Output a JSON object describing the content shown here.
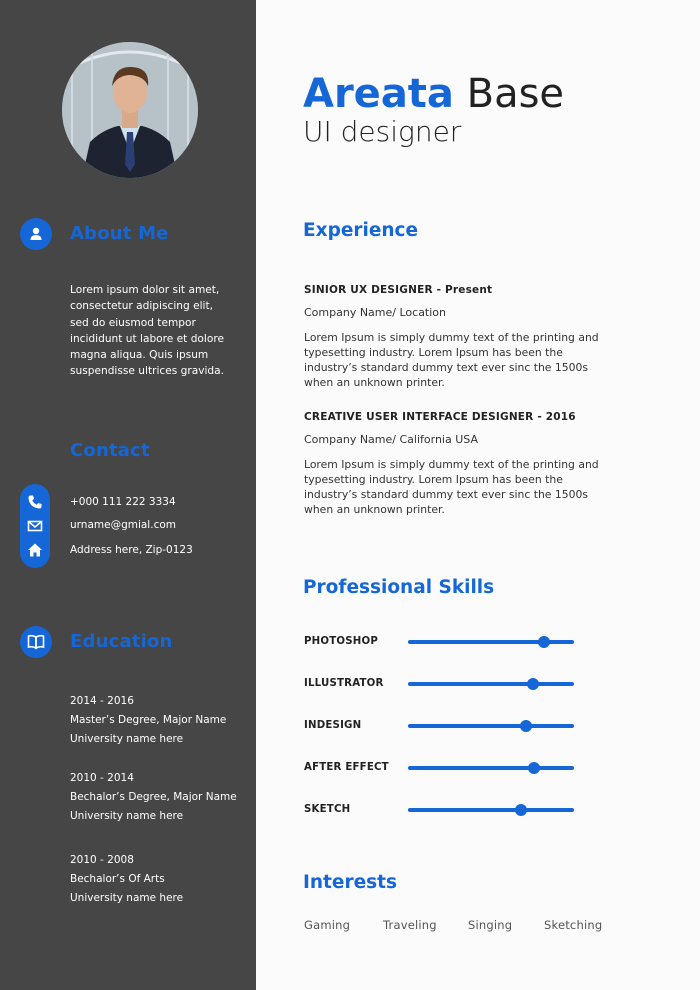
{
  "profile": {
    "first_name": "Areata",
    "last_name": "Base",
    "role": "UI designer"
  },
  "sidebar": {
    "about": {
      "heading": "About Me",
      "text": "Lorem ipsum dolor sit amet, consectetur adipiscing elit, sed do eiusmod tempor incididunt ut labore et dolore magna aliqua. Quis ipsum suspendisse ultrices gravida."
    },
    "contact": {
      "heading": "Contact",
      "phone": "+000 111 222 3334",
      "email": "urname@gmial.com",
      "address": "Address here, Zip-0123"
    },
    "education": {
      "heading": "Education",
      "items": [
        {
          "years": "2014 - 2016",
          "degree": "Master’s Degree, Major Name",
          "school": "University name here"
        },
        {
          "years": "2010 - 2014",
          "degree": "Bechalor’s Degree, Major Name",
          "school": "University name here"
        },
        {
          "years": "2010 - 2008",
          "degree": "Bechalor’s Of Arts",
          "school": "University name here"
        }
      ]
    }
  },
  "experience": {
    "heading": "Experience",
    "jobs": [
      {
        "title": "SINIOR UX DESIGNER - Present",
        "company": "Company Name/ Location",
        "description": "Lorem Ipsum is simply dummy text of the printing and typesetting industry. Lorem Ipsum has been the industry’s standard dummy text ever sinc the 1500s when an unknown printer."
      },
      {
        "title": "CREATIVE USER INTERFACE DESIGNER - 2016",
        "company": "Company Name/ California USA",
        "description": "Lorem Ipsum is simply dummy text of the printing and typesetting industry. Lorem Ipsum has been the industry’s standard dummy text ever sinc the 1500s when an unknown printer."
      }
    ]
  },
  "skills": {
    "heading": "Professional Skills",
    "items": [
      {
        "name": "PHOTOSHOP",
        "level": 0.82
      },
      {
        "name": "ILLUSTRATOR",
        "level": 0.75
      },
      {
        "name": "INDESIGN",
        "level": 0.71
      },
      {
        "name": "AFTER EFFECT",
        "level": 0.76
      },
      {
        "name": "SKETCH",
        "level": 0.68
      }
    ]
  },
  "interests": {
    "heading": "Interests",
    "items": [
      "Gaming",
      "Traveling",
      "Singing",
      "Sketching"
    ]
  },
  "colors": {
    "accent": "#1566d6",
    "sidebar_bg": "#464646"
  },
  "icons": {
    "about": "user-icon",
    "phone": "phone-icon",
    "email": "envelope-icon",
    "address": "home-icon",
    "education": "book-icon"
  }
}
